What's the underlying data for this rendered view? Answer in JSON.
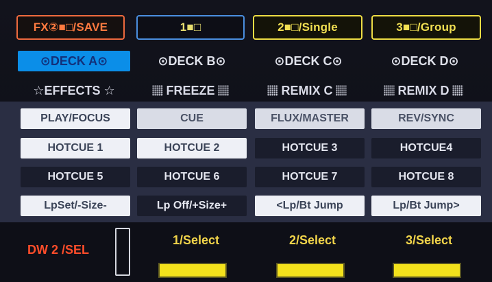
{
  "function_row": {
    "fx_save": "FX②■□/SAVE",
    "btn1": "1■□",
    "btn2": "2■□/Single",
    "btn3": "3■□/Group"
  },
  "decks": {
    "a": "⊙DECK A⊙",
    "b": "⊙DECK B⊙",
    "c": "⊙DECK C⊙",
    "d": "⊙DECK D⊙",
    "active": "a"
  },
  "modes": {
    "effects": "☆EFFECTS ☆",
    "freeze": "FREEZE",
    "remix_c": "REMIX C",
    "remix_d": "REMIX D"
  },
  "pads": {
    "row1": [
      "PLAY/FOCUS",
      "CUE",
      "FLUX/MASTER",
      "REV/SYNC"
    ],
    "row2": [
      "HOTCUE 1",
      "HOTCUE 2",
      "HOTCUE 3",
      "HOTCUE4"
    ],
    "row3": [
      "HOTCUE 5",
      "HOTCUE 6",
      "HOTCUE 7",
      "HOTCUE 8"
    ],
    "row4": [
      "LpSet/-Size-",
      "Lp Off/+Size+",
      "<Lp/Bt Jump",
      "Lp/Bt Jump>"
    ]
  },
  "bottom": {
    "dw_label": "DW 2 /SEL",
    "selects": [
      "1/Select",
      "2/Select",
      "3/Select"
    ]
  },
  "colors": {
    "accent_yellow": "#f1df52",
    "accent_red": "#ff7b40",
    "deck_active": "#0b8ee8",
    "select_bar": "#f3e11c"
  }
}
